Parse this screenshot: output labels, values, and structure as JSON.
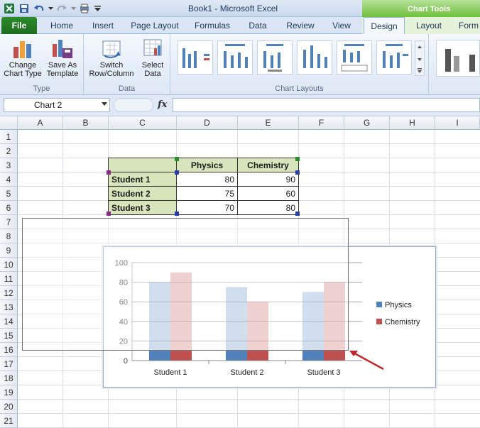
{
  "window": {
    "title": "Book1 - Microsoft Excel",
    "context_title": "Chart Tools"
  },
  "tabs": [
    "File",
    "Home",
    "Insert",
    "Page Layout",
    "Formulas",
    "Data",
    "Review",
    "View",
    "Design",
    "Layout",
    "Form"
  ],
  "active_tab": "Design",
  "ribbon": {
    "groups": [
      {
        "label": "Type",
        "buttons": [
          "Change\nChart Type",
          "Save As\nTemplate"
        ]
      },
      {
        "label": "Data",
        "buttons": [
          "Switch\nRow/Column",
          "Select\nData"
        ]
      },
      {
        "label": "Chart Layouts"
      }
    ]
  },
  "formula_bar": {
    "name_box": "Chart 2",
    "fx": "fx",
    "value": ""
  },
  "columns": [
    "A",
    "B",
    "C",
    "D",
    "E",
    "F",
    "G",
    "H",
    "I"
  ],
  "rows": [
    "1",
    "2",
    "3",
    "4",
    "5",
    "6",
    "7",
    "8",
    "9",
    "10",
    "11",
    "12",
    "13",
    "14",
    "15",
    "16",
    "17",
    "18",
    "19",
    "20",
    "21"
  ],
  "table": {
    "headers": [
      "",
      "Physics",
      "Chemistry"
    ],
    "rows": [
      {
        "name": "Student 1",
        "physics": "80",
        "chemistry": "90"
      },
      {
        "name": "Student 2",
        "physics": "75",
        "chemistry": "60"
      },
      {
        "name": "Student 3",
        "physics": "70",
        "chemistry": "80"
      }
    ]
  },
  "chart_data": {
    "type": "bar",
    "categories": [
      "Student 1",
      "Student 2",
      "Student 3"
    ],
    "series": [
      {
        "name": "Physics",
        "values": [
          80,
          75,
          70
        ],
        "color": "#4f81bd"
      },
      {
        "name": "Chemistry",
        "values": [
          90,
          60,
          80
        ],
        "color": "#c0504d"
      }
    ],
    "ylim": [
      0,
      100
    ],
    "yticks": [
      "0",
      "20",
      "40",
      "60",
      "80",
      "100"
    ],
    "grid": true,
    "legend": "right"
  }
}
